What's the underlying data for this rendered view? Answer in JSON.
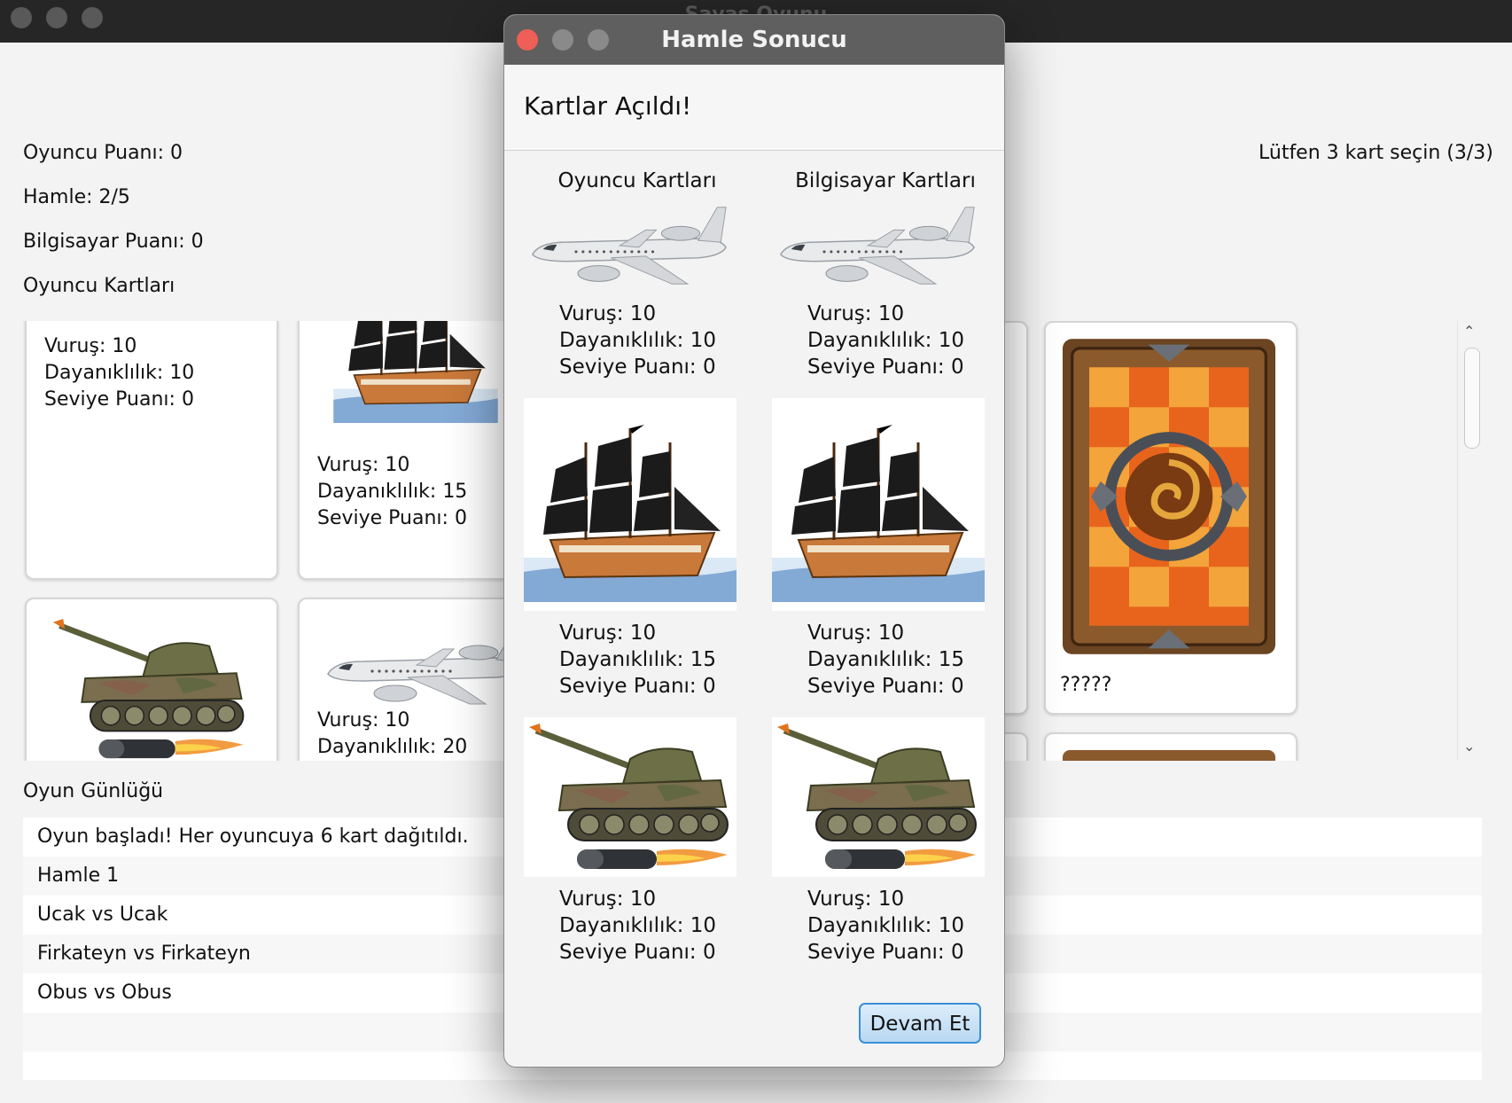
{
  "window": {
    "title": "Savaş Oyunu"
  },
  "scores": {
    "player": "Oyuncu Puanı: 0",
    "move": "Hamle: 2/5",
    "computer": "Bilgisayar Puanı: 0",
    "instruction": "Lütfen 3 kart seçin (3/3)"
  },
  "section": {
    "player_cards": "Oyuncu Kartları",
    "log": "Oyun Günlüğü"
  },
  "cards": [
    {
      "type": "plane-icon",
      "hit": "Vuruş: 10",
      "durability": "Dayanıklılık: 10",
      "level": "Seviye Puanı: 0"
    },
    {
      "type": "ship-icon",
      "hit": "Vuruş: 10",
      "durability": "Dayanıklılık: 15",
      "level": "Seviye Puanı: 0"
    },
    {
      "type": "tank-icon"
    },
    {
      "type": "plane-icon",
      "hit": "Vuruş: 10",
      "durability": "Dayanıklılık: 20"
    },
    {
      "type": "card-back-icon",
      "hidden_label": "?????"
    }
  ],
  "log": [
    "Oyun başladı! Her oyuncuya 6 kart dağıtıldı.",
    "Hamle 1",
    "Ucak vs Ucak",
    "Firkateyn vs Firkateyn",
    "Obus vs Obus",
    "",
    ""
  ],
  "dialog": {
    "title": "Hamle Sonucu",
    "header": "Kartlar Açıldı!",
    "player_col": "Oyuncu Kartları",
    "computer_col": "Bilgisayar Kartları",
    "rows": [
      {
        "icon": "plane-icon",
        "player": {
          "hit": "Vuruş: 10",
          "durability": "Dayanıklılık: 10",
          "level": "Seviye Puanı: 0"
        },
        "computer": {
          "hit": "Vuruş: 10",
          "durability": "Dayanıklılık: 10",
          "level": "Seviye Puanı: 0"
        }
      },
      {
        "icon": "ship-icon",
        "player": {
          "hit": "Vuruş: 10",
          "durability": "Dayanıklılık: 15",
          "level": "Seviye Puanı: 0"
        },
        "computer": {
          "hit": "Vuruş: 10",
          "durability": "Dayanıklılık: 15",
          "level": "Seviye Puanı: 0"
        }
      },
      {
        "icon": "tank-icon",
        "player": {
          "hit": "Vuruş: 10",
          "durability": "Dayanıklılık: 10",
          "level": "Seviye Puanı: 0"
        },
        "computer": {
          "hit": "Vuruş: 10",
          "durability": "Dayanıklılık: 10",
          "level": "Seviye Puanı: 0"
        }
      }
    ],
    "continue_button": "Devam Et"
  }
}
